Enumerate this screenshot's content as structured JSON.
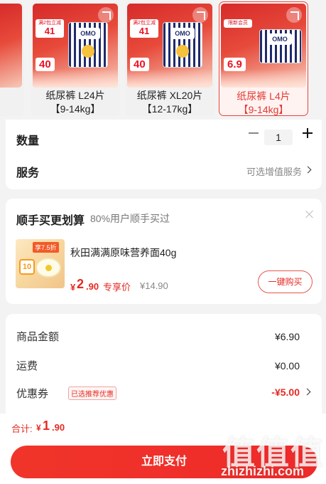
{
  "variants": [
    {
      "name": "纸尿裤 L24片",
      "size": "【9-14kg】",
      "badge_small": "满2包立减",
      "badge_num": "41",
      "price_tag": "40",
      "logo": "OMO"
    },
    {
      "name": "纸尿裤 XL20片",
      "size": "【12-17kg】",
      "badge_small": "满2包立减",
      "badge_num": "41",
      "price_tag": "40",
      "logo": "OMO"
    },
    {
      "name": "纸尿裤 L4片",
      "size": "【9-14kg】",
      "badge_small": "限新会员",
      "badge_num": "",
      "price_tag": "6.9",
      "logo": "OMO"
    }
  ],
  "quantity": {
    "label": "数量",
    "value": "1"
  },
  "service": {
    "label": "服务",
    "hint": "可选增值服务"
  },
  "recommend": {
    "title": "顺手买更划算",
    "subtitle": "80%用户顺手买过",
    "product": {
      "name": "秋田满满原味营养面40g",
      "img_tag": "享7.5折",
      "img_num": "10",
      "price_symbol": "¥",
      "price_int": "2",
      "price_dec": ".90",
      "price_tag": "专享价",
      "original_price": "¥14.90",
      "buy_label": "一键购买"
    }
  },
  "summary": {
    "goods_label": "商品金额",
    "goods_value": "¥6.90",
    "shipping_label": "运费",
    "shipping_value": "¥0.00",
    "coupon_label": "优惠券",
    "coupon_badge": "已选推荐优惠",
    "coupon_value": "-¥5.00"
  },
  "footer": {
    "total_label": "合计:",
    "total_symbol": "¥",
    "total_int": "1",
    "total_dec": ".90",
    "pay_label": "立即支付"
  },
  "watermark": {
    "chars": "值值值",
    "url": "zhizhizhi.com"
  },
  "colors": {
    "accent": "#e52a22",
    "selected_border": "#e8453d",
    "background": "#f3f3f3"
  }
}
